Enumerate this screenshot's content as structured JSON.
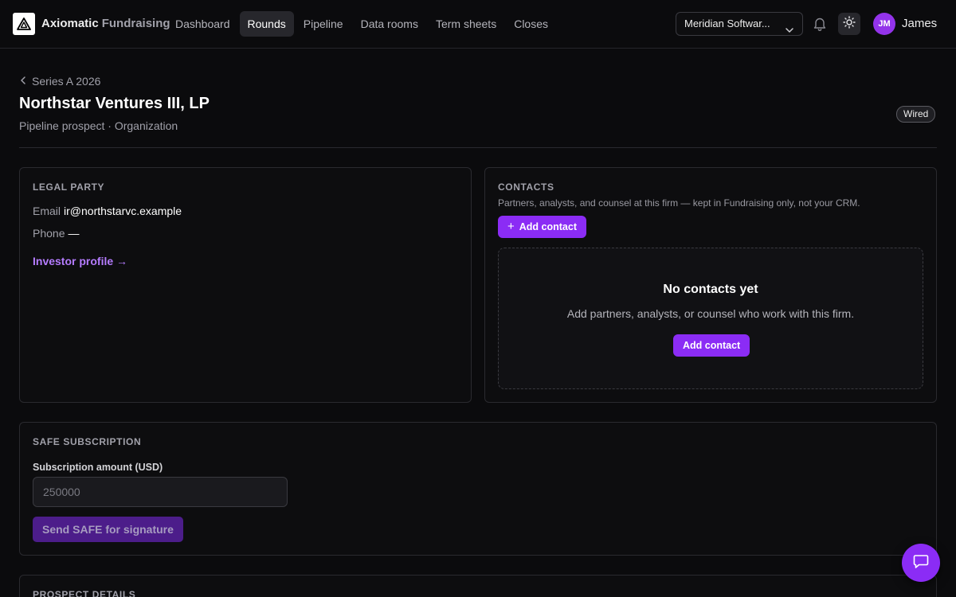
{
  "brand": {
    "name": "Axiomatic",
    "product": "Fundraising"
  },
  "nav": {
    "items": [
      {
        "label": "Dashboard"
      },
      {
        "label": "Rounds"
      },
      {
        "label": "Pipeline"
      },
      {
        "label": "Data rooms"
      },
      {
        "label": "Term sheets"
      },
      {
        "label": "Closes"
      }
    ],
    "active": "Rounds"
  },
  "header": {
    "org_selector": "Meridian Softwar...",
    "user": {
      "initials": "JM",
      "name": "James"
    },
    "icons": [
      "bell-icon",
      "sun-icon",
      "chevron-down-icon"
    ]
  },
  "page": {
    "breadcrumb": "Series A 2026",
    "title": "Northstar Ventures III, LP",
    "subtitle": "Pipeline prospect · Organization",
    "status": "Wired"
  },
  "legal_party": {
    "title": "LEGAL PARTY",
    "email_label": "Email",
    "email_value": "ir@northstarvc.example",
    "phone_label": "Phone",
    "phone_value": "—",
    "investor_link": "Investor profile →"
  },
  "contacts": {
    "title": "CONTACTS",
    "description": "Partners, analysts, and counsel at this firm — kept in Fundraising only, not your CRM.",
    "add_button": "Add contact",
    "empty_title": "No contacts yet",
    "empty_description": "Add partners, analysts, or counsel who work with this firm.",
    "empty_button": "Add contact"
  },
  "safe_subscription": {
    "title": "SAFE SUBSCRIPTION",
    "amount_label": "Subscription amount (USD)",
    "amount_placeholder": "250000",
    "amount_value": "",
    "send_button": "Send SAFE for signature"
  },
  "prospect_details": {
    "title": "PROSPECT DETAILS"
  },
  "colors": {
    "accent": "#8b2cf5",
    "link": "#b57cff",
    "background": "#0b0b0d",
    "avatar": "#9333ea"
  }
}
